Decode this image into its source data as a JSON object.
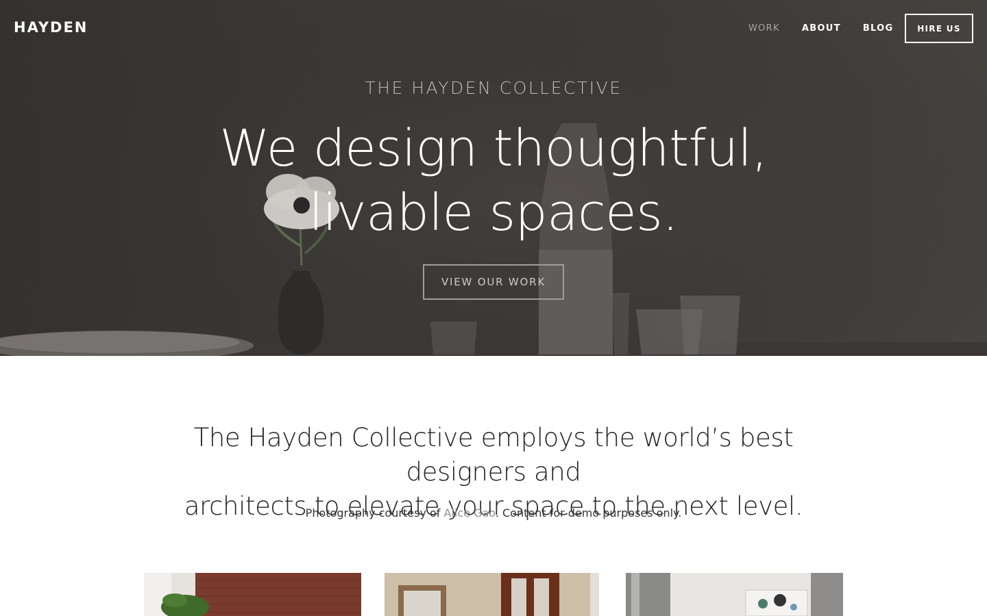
{
  "header": {
    "logo": "HAYDEN",
    "nav": [
      {
        "label": "WORK",
        "active": true
      },
      {
        "label": "ABOUT",
        "active": false
      },
      {
        "label": "BLOG",
        "active": false
      }
    ],
    "cta_label": "HIRE US"
  },
  "hero": {
    "kicker": "THE HAYDEN COLLECTIVE",
    "title_line1": "We design thoughtful,",
    "title_line2": "livable spaces.",
    "cta_label": "VIEW OUR WORK"
  },
  "intro": {
    "headline_line1": "The Hayden Collective employs the world’s best designers and",
    "headline_line2": "architects to elevate your space to the next level.",
    "credit_prefix": "Photography courtesy of ",
    "credit_link": "Alice Gao",
    "credit_suffix": ". Content for demo purposes only."
  },
  "colors": {
    "hero_bg": "#3c3836",
    "nav_active": "#a6a29f",
    "link_muted": "#8f8f8f",
    "text": "#222222"
  }
}
